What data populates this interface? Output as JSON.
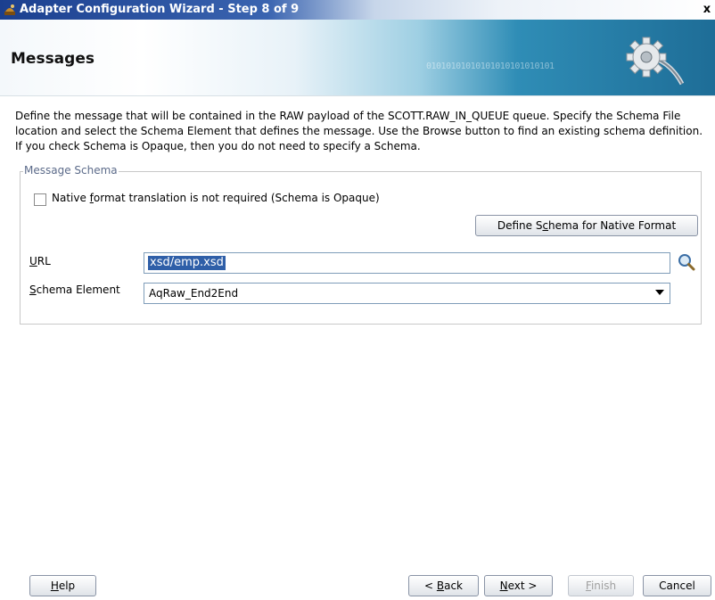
{
  "window": {
    "title": "Adapter Configuration Wizard - Step 8 of 9",
    "close_label": "x"
  },
  "header": {
    "page_title": "Messages",
    "binary_decoration": "01010101010101010101010101"
  },
  "description": "Define the message that will be contained in the RAW payload of the SCOTT.RAW_IN_QUEUE queue.  Specify the Schema File location and select the Schema Element that defines the message. Use the Browse button to find an existing schema definition. If you check Schema is Opaque, then you do not need to specify a Schema.",
  "message_schema": {
    "legend": "Message Schema",
    "opaque_checkbox": {
      "label_pre": "Native ",
      "label_mnemonic": "f",
      "label_post": "ormat translation is not required (Schema is Opaque)",
      "checked": false
    },
    "define_button": {
      "pre": "Define S",
      "mnemonic": "c",
      "post": "hema for Native Format"
    },
    "url": {
      "label_mnemonic": "U",
      "label_post": "RL",
      "value": "xsd/emp.xsd"
    },
    "schema_element": {
      "label_mnemonic": "S",
      "label_post": "chema Element",
      "selected": "AqRaw_End2End"
    }
  },
  "footer": {
    "help": {
      "mnemonic": "H",
      "post": "elp"
    },
    "back": {
      "pre": "< ",
      "mnemonic": "B",
      "post": "ack"
    },
    "next": {
      "mnemonic": "N",
      "post": "ext >"
    },
    "finish": {
      "mnemonic": "F",
      "post": "inish",
      "enabled": false
    },
    "cancel": {
      "label": "Cancel"
    }
  },
  "colors": {
    "title_bar": "#1b3f8f",
    "header_accent": "#2f8db6",
    "selection": "#2f5fa8",
    "legend_text": "#5c6b8a"
  },
  "icons": [
    "app-icon",
    "close-icon",
    "gear-icon",
    "search-icon",
    "chevron-down-icon"
  ]
}
